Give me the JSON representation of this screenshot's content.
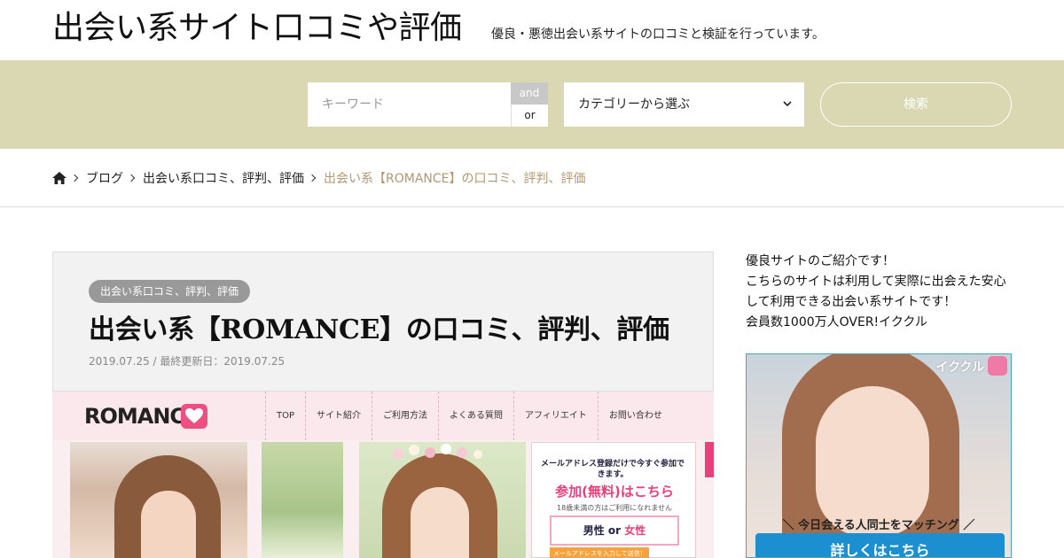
{
  "header": {
    "site_title": "出会い系サイト口コミや評価",
    "site_description": "優良・悪徳出会い系サイトの口コミと検証を行っています。"
  },
  "search": {
    "keyword_placeholder": "キーワード",
    "keyword_value": "",
    "and_label": "and",
    "or_label": "or",
    "category_selected": "カテゴリーから選ぶ",
    "submit_label": "検索"
  },
  "breadcrumb": {
    "items": [
      "ブログ",
      "出会い系口コミ、評判、評価",
      "出会い系【ROMANCE】の口コミ、評判、評価"
    ]
  },
  "article": {
    "category_badge": "出会い系口コミ、評判、評価",
    "title": "出会い系【ROMANCE】の口コミ、評判、評価",
    "date_line": "2019.07.25 / 最終更新日：2019.07.25"
  },
  "article_image": {
    "logo_text": "ROMANCE",
    "menu": [
      "TOP",
      "サイト紹介",
      "ご利用方法",
      "よくある質問",
      "アフィリエイト",
      "お問い合わせ"
    ],
    "panel_line1": "メールアドレス登録だけで今すぐ参加できます。",
    "panel_line2": "参加(無料)はこちら",
    "panel_line3": "18歳未満の方はご利用になれません",
    "panel_male": "男性",
    "panel_or": "or",
    "panel_female": "女性",
    "panel_email_hint": "メールアドレスを入力して送信！"
  },
  "sidebar": {
    "lines": [
      "優良サイトのご紹介です！",
      "こちらのサイトは利用して実際に出会えた安心",
      "して利用できる出会い系サイトです！",
      "会員数1000万人OVER!イククル"
    ],
    "ad": {
      "brand": "イククル",
      "tagline": "＼ 今日会える人同士をマッチング ／",
      "cta": "詳しくはこちら"
    }
  },
  "colors": {
    "search_band": "#d9d8b3",
    "breadcrumb_current": "#b09870",
    "romance_pink": "#ec4f82",
    "cta_blue": "#1b8fd0"
  }
}
